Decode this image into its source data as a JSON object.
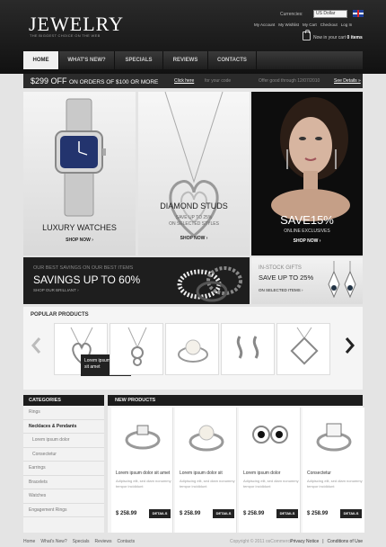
{
  "header": {
    "logo": "JEWELRY",
    "tagline": "THE BIGGEST CHOICE ON THE WEB",
    "currency_label": "Currencies:",
    "currency_value": "US Dollar",
    "top_links": [
      "My Account",
      "My Wishlist",
      "My Cart",
      "Checkout",
      "Log In"
    ],
    "cart_prefix": "Now in your cart",
    "cart_count": "0 items"
  },
  "nav": {
    "items": [
      "HOME",
      "WHAT'S NEW?",
      "SPECIALS",
      "REVIEWS",
      "CONTACTS"
    ]
  },
  "promo": {
    "amount": "$299 OFF",
    "text": "ON ORDERS OF $100 OR MORE",
    "code_link": "Click here",
    "code_text": "for your code",
    "expires": "Offer good through 12/07/2010",
    "details": "See Details »"
  },
  "banners": {
    "watches": {
      "title": "LUXURY WATCHES",
      "cta": "SHOP NOW ›"
    },
    "studs": {
      "title": "DIAMOND STUDS",
      "sub1": "SAVE UP TO 25%",
      "sub2": "ON SELECTED STYLES",
      "cta": "SHOP NOW ›"
    },
    "save": {
      "title": "SAVE15%",
      "sub": "ONLINE EXCLUSIVES",
      "cta": "SHOP NOW ›"
    },
    "savings": {
      "top": "OUR BEST SAVINGS ON OUR BEST ITEMS",
      "title": "SAVINGS UP TO 60%",
      "cta": "SHOP OUR BRILLIANT ›"
    },
    "gifts": {
      "top": "IN-STOCK GIFTS",
      "title": "SAVE UP TO 25%",
      "cta": "ON SELECTED ITEMS ›"
    }
  },
  "popular": {
    "title": "POPULAR PRODUCTS",
    "tooltip_line1": "Lorem ipsum dolor",
    "tooltip_line2": "sit amet"
  },
  "categories": {
    "title": "CATEGORIES",
    "items": [
      {
        "label": "Rings",
        "sub": false,
        "on": false
      },
      {
        "label": "Necklaces & Pendants",
        "sub": false,
        "on": true
      },
      {
        "label": "Lorem ipsum dolor",
        "sub": true,
        "on": false
      },
      {
        "label": "Consectetur",
        "sub": true,
        "on": false
      },
      {
        "label": "Earrings",
        "sub": false,
        "on": false
      },
      {
        "label": "Bracelets",
        "sub": false,
        "on": false
      },
      {
        "label": "Watches",
        "sub": false,
        "on": false
      },
      {
        "label": "Engagement Rings",
        "sub": false,
        "on": false
      }
    ]
  },
  "new_products": {
    "title": "NEW PRODUCTS",
    "items": [
      {
        "name": "Lorem ipsum dolor sit amet",
        "desc": "Adipiscing elit, sed diam nonummy tempor incididunt",
        "price": "$ 258.99",
        "btn": "DETAILS"
      },
      {
        "name": "Lorem ipsum dolor sit",
        "desc": "Adipiscing elit, sed diam nonummy tempor incididunt",
        "price": "$ 258.99",
        "btn": "DETAILS"
      },
      {
        "name": "Lorem ipsum dolor",
        "desc": "Adipiscing elit, sed diam nonummy tempor incididunt",
        "price": "$ 258.99",
        "btn": "DETAILS"
      },
      {
        "name": "Consectetur",
        "desc": "Adipiscing elit, sed diam nonummy tempor incididunt",
        "price": "$ 258.99",
        "btn": "DETAILS"
      }
    ]
  },
  "footer": {
    "links": [
      "Home",
      "What's New?",
      "Specials",
      "Reviews",
      "Contacts"
    ],
    "copyright": "Copyright © 2011 osCommerce",
    "right_links": [
      "Privacy Notice",
      "|",
      "Conditions of Use"
    ]
  },
  "colors": {
    "header_bg": "#1a1a1a",
    "accent": "#222222",
    "page_bg": "#e4e4e4"
  }
}
